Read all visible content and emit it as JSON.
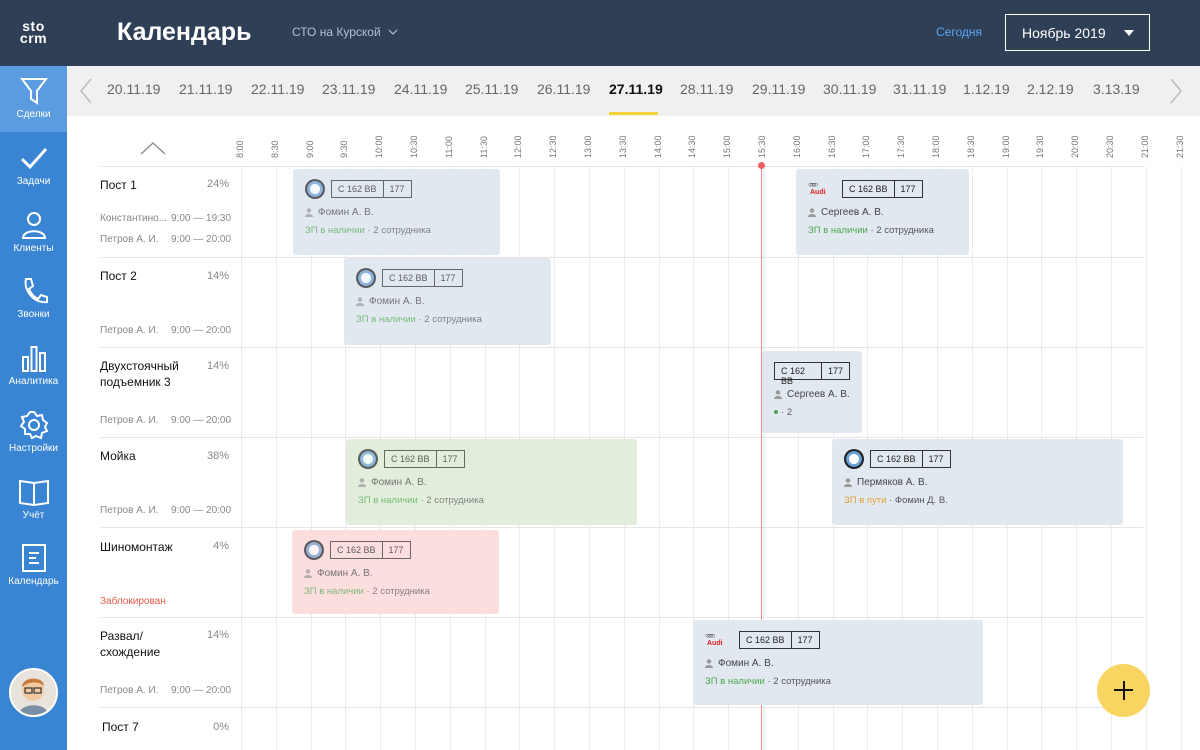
{
  "logo": "sto crm",
  "header": {
    "title": "Календарь",
    "station": "СТО на Курской",
    "today": "Сегодня",
    "month": "Ноябрь 2019"
  },
  "sidebar": {
    "items": [
      {
        "label": "Сделки",
        "icon": "funnel-icon"
      },
      {
        "label": "Задачи",
        "icon": "check-icon"
      },
      {
        "label": "Клиенты",
        "icon": "person-icon"
      },
      {
        "label": "Звонки",
        "icon": "phone-icon"
      },
      {
        "label": "Аналитика",
        "icon": "bars-icon"
      },
      {
        "label": "Настройки",
        "icon": "gear-icon"
      },
      {
        "label": "Учёт",
        "icon": "book-icon"
      },
      {
        "label": "Календарь",
        "icon": "calendar-icon"
      }
    ]
  },
  "dates": [
    "20.11.19",
    "21.11.19",
    "22.11.19",
    "23.11.19",
    "24.11.19",
    "25.11.19",
    "26.11.19",
    "27.11.19",
    "28.11.19",
    "29.11.19",
    "30.11.19",
    "31.11.19",
    "1.12.19",
    "2.12.19",
    "3.13.19"
  ],
  "times": [
    "8:00",
    "8:30",
    "9:00",
    "9:30",
    "10:00",
    "10:30",
    "11:00",
    "11:30",
    "12:00",
    "12:30",
    "13:00",
    "13:30",
    "14:00",
    "14:30",
    "15:00",
    "15:30",
    "16:00",
    "16:30",
    "17:00",
    "17:30",
    "18:00",
    "18:30",
    "19:00",
    "19:30",
    "20:00",
    "20:30",
    "21:00",
    "21:30"
  ],
  "rows": [
    {
      "name": "Пост 1",
      "pct": "24%",
      "employees": [
        {
          "name": "Константино...",
          "time": "9:00 — 19:30"
        },
        {
          "name": "Петров А. И.",
          "time": "9:00 — 20:00"
        }
      ]
    },
    {
      "name": "Пост 2",
      "pct": "14%",
      "employees": [
        {
          "name": "Петров А. И.",
          "time": "9:00 — 20:00"
        }
      ]
    },
    {
      "name": "Двухстоячный подъемник 3",
      "pct": "14%",
      "employees": [
        {
          "name": "Петров А. И.",
          "time": "9:00 — 20:00"
        }
      ]
    },
    {
      "name": "Мойка",
      "pct": "38%",
      "employees": [
        {
          "name": "Петров А. И.",
          "time": "9:00 — 20:00"
        }
      ]
    },
    {
      "name": "Шиномонтаж",
      "pct": "4%",
      "status": "Заблокирован"
    },
    {
      "name": "Развал/ схождение",
      "pct": "14%",
      "employees": [
        {
          "name": "Петров А. И.",
          "time": "9:00 — 20:00"
        }
      ]
    },
    {
      "name": "Пост 7",
      "pct": "0%"
    }
  ],
  "cards": [
    {
      "brand": "bmw",
      "plate": "С 162 ВВ",
      "region": "177",
      "person": "Фомин А. В.",
      "status": "ЗП в наличии",
      "extra": "2 сотрудника"
    },
    {
      "brand": "audi",
      "plate": "С 162 ВВ",
      "region": "177",
      "person": "Сергеев А. В.",
      "status": "ЗП в наличии",
      "extra": "2 сотрудника"
    },
    {
      "brand": "bmw",
      "plate": "С 162 ВВ",
      "region": "177",
      "person": "Фомин А. В.",
      "status": "ЗП в наличии",
      "extra": "2 сотрудника"
    },
    {
      "brand": "none",
      "plate": "С 162 ВВ",
      "region": "177",
      "person": "Сергеев А. В.",
      "status": "",
      "extra": "2"
    },
    {
      "brand": "bmw",
      "plate": "С 162 ВВ",
      "region": "177",
      "person": "Фомин А. В.",
      "status": "ЗП в наличии",
      "extra": "2 сотрудника"
    },
    {
      "brand": "bmw",
      "plate": "С 162 ВВ",
      "region": "177",
      "person": "Пермяков А. В.",
      "status": "ЗП в пути",
      "extra": "Фомин Д. В."
    },
    {
      "brand": "bmw",
      "plate": "С 162 ВВ",
      "region": "177",
      "person": "Фомин А. В.",
      "status": "ЗП в наличии",
      "extra": "2 сотрудника"
    },
    {
      "brand": "audi",
      "plate": "С 162 ВВ",
      "region": "177",
      "person": "Фомин А. В.",
      "status": "ЗП в наличии",
      "extra": "2 сотрудника"
    }
  ],
  "colors": {
    "sidebar": "#3a84d4",
    "header": "#2f3f56",
    "accent": "#f5d23c",
    "fab": "#f8d460",
    "now": "#f06060"
  }
}
